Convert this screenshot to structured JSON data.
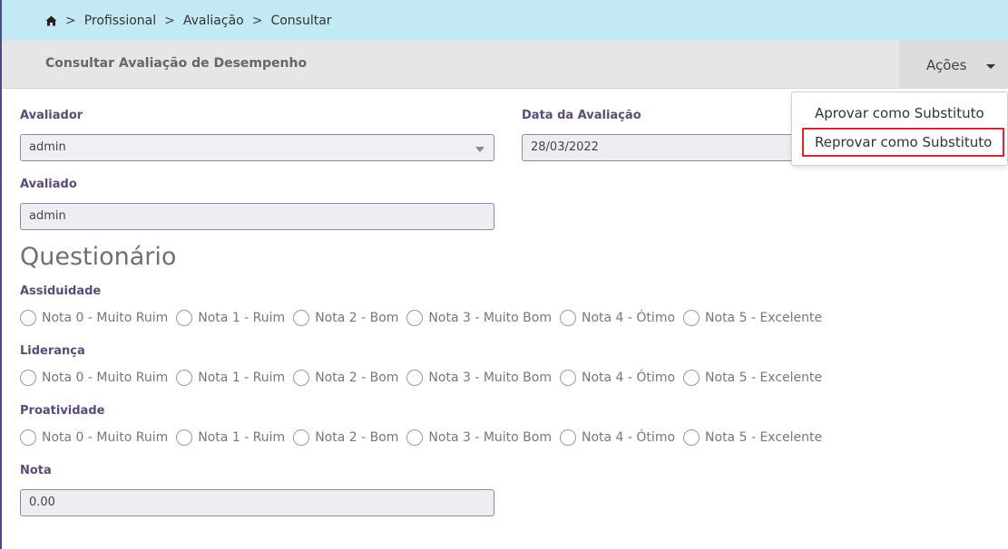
{
  "breadcrumb": {
    "items": [
      "Profissional",
      "Avaliação",
      "Consultar"
    ],
    "separator": ">"
  },
  "header": {
    "title": "Consultar Avaliação de Desempenho",
    "actions_label": "Ações"
  },
  "actions_menu": {
    "items": [
      "Aprovar como Substituto",
      "Reprovar como Substituto"
    ]
  },
  "form": {
    "avaliador_label": "Avaliador",
    "avaliador_value": "admin",
    "data_label": "Data da Avaliação",
    "data_value": "28/03/2022",
    "avaliado_label": "Avaliado",
    "avaliado_value": "admin"
  },
  "questionario": {
    "title": "Questionário",
    "options": [
      "Nota 0 - Muito Ruim",
      "Nota 1 - Ruim",
      "Nota 2 - Bom",
      "Nota 3 - Muito Bom",
      "Nota 4 - Ótimo",
      "Nota 5 - Excelente"
    ],
    "questions": [
      "Assiduidade",
      "Liderança",
      "Proatividade"
    ]
  },
  "nota": {
    "label": "Nota",
    "value": "0.00"
  },
  "colors": {
    "breadcrumb_bg": "#c3e9f5",
    "label_color": "#5c4a7a",
    "highlight_border": "#d6262f"
  }
}
